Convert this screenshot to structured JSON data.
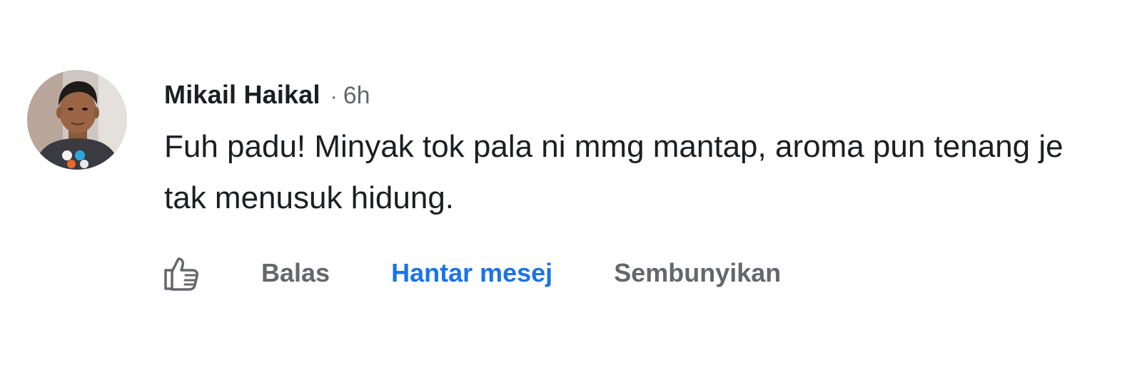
{
  "comment": {
    "author": "Mikail Haikal",
    "separator": "·",
    "time": "6h",
    "text": "Fuh padu! Minyak tok pala ni mmg mantap, aroma pun tenang je tak menusuk hidung.",
    "avatar_icon": "profile-photo"
  },
  "actions": {
    "like_icon": "thumbs-up-icon",
    "reply_label": "Balas",
    "message_label": "Hantar mesej",
    "hide_label": "Sembunyikan"
  },
  "colors": {
    "text_primary": "#1c1e21",
    "text_secondary": "#65676b",
    "link_blue": "#1a73e8",
    "background": "#ffffff"
  }
}
